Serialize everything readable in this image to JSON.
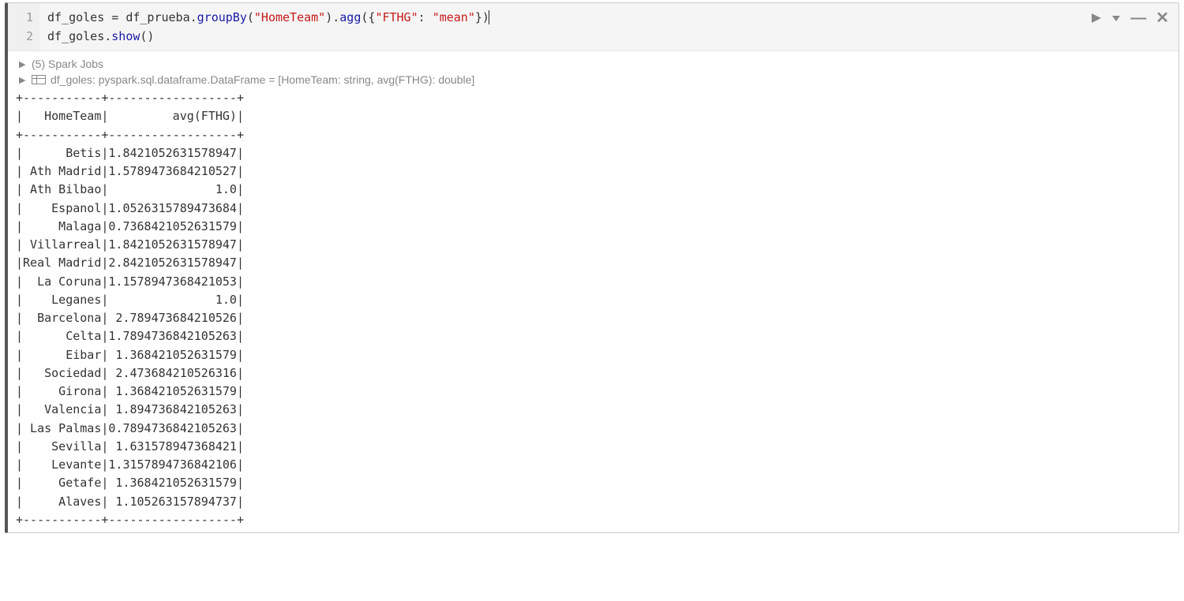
{
  "cell": {
    "label": "",
    "lines": [
      "1",
      "2"
    ],
    "code_tokens": [
      [
        {
          "t": "df_goles ",
          "c": ""
        },
        {
          "t": "=",
          "c": ""
        },
        {
          "t": " df_prueba.",
          "c": ""
        },
        {
          "t": "groupBy",
          "c": "tok-fn"
        },
        {
          "t": "(",
          "c": ""
        },
        {
          "t": "\"HomeTeam\"",
          "c": "tok-str"
        },
        {
          "t": ").",
          "c": ""
        },
        {
          "t": "agg",
          "c": "tok-fn"
        },
        {
          "t": "({",
          "c": ""
        },
        {
          "t": "\"FTHG\"",
          "c": "tok-str"
        },
        {
          "t": ": ",
          "c": ""
        },
        {
          "t": "\"mean\"",
          "c": "tok-str"
        },
        {
          "t": "})",
          "c": ""
        }
      ],
      [
        {
          "t": "df_goles.",
          "c": ""
        },
        {
          "t": "show",
          "c": "tok-fn"
        },
        {
          "t": "()",
          "c": ""
        }
      ]
    ]
  },
  "output": {
    "spark_jobs": "(5) Spark Jobs",
    "schema": "df_goles:  pyspark.sql.dataframe.DataFrame = [HomeTeam: string, avg(FTHG): double]",
    "table": {
      "col1_header": "HomeTeam",
      "col2_header": "avg(FTHG)",
      "col1_width": 11,
      "col2_width": 18,
      "rows": [
        {
          "team": "Betis",
          "avg": "1.8421052631578947"
        },
        {
          "team": "Ath Madrid",
          "avg": "1.5789473684210527"
        },
        {
          "team": "Ath Bilbao",
          "avg": "1.0"
        },
        {
          "team": "Espanol",
          "avg": "1.0526315789473684"
        },
        {
          "team": "Malaga",
          "avg": "0.7368421052631579"
        },
        {
          "team": "Villarreal",
          "avg": "1.8421052631578947"
        },
        {
          "team": "Real Madrid",
          "avg": "2.8421052631578947"
        },
        {
          "team": "La Coruna",
          "avg": "1.1578947368421053"
        },
        {
          "team": "Leganes",
          "avg": "1.0"
        },
        {
          "team": "Barcelona",
          "avg": "2.789473684210526"
        },
        {
          "team": "Celta",
          "avg": "1.7894736842105263"
        },
        {
          "team": "Eibar",
          "avg": "1.368421052631579"
        },
        {
          "team": "Sociedad",
          "avg": "2.473684210526316"
        },
        {
          "team": "Girona",
          "avg": "1.368421052631579"
        },
        {
          "team": "Valencia",
          "avg": "1.894736842105263"
        },
        {
          "team": "Las Palmas",
          "avg": "0.7894736842105263"
        },
        {
          "team": "Sevilla",
          "avg": "1.631578947368421"
        },
        {
          "team": "Levante",
          "avg": "1.3157894736842106"
        },
        {
          "team": "Getafe",
          "avg": "1.368421052631579"
        },
        {
          "team": "Alaves",
          "avg": "1.105263157894737"
        }
      ]
    }
  }
}
